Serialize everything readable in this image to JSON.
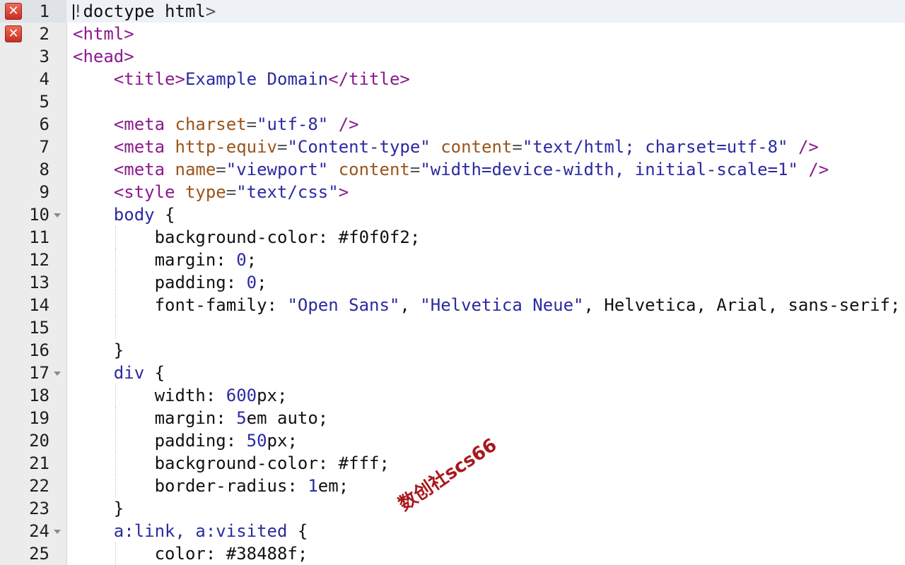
{
  "editor": {
    "lines": [
      {
        "num": "1",
        "error": true,
        "fold": false,
        "active": true,
        "tokens": [
          {
            "t": "punct",
            "v": "!"
          },
          {
            "t": "prop",
            "v": "doctype html"
          },
          {
            "t": "punct",
            "v": ">"
          }
        ]
      },
      {
        "num": "2",
        "error": true,
        "fold": false,
        "active": false,
        "tokens": [
          {
            "t": "tag",
            "v": "<html>"
          }
        ]
      },
      {
        "num": "3",
        "error": false,
        "fold": false,
        "active": false,
        "tokens": [
          {
            "t": "tag",
            "v": "<head>"
          }
        ]
      },
      {
        "num": "4",
        "error": false,
        "fold": false,
        "active": false,
        "tokens": [
          {
            "t": "prop",
            "v": "    "
          },
          {
            "t": "tag",
            "v": "<title>"
          },
          {
            "t": "str",
            "v": "Example Domain"
          },
          {
            "t": "tag",
            "v": "</title>"
          }
        ]
      },
      {
        "num": "5",
        "error": false,
        "fold": false,
        "active": false,
        "tokens": []
      },
      {
        "num": "6",
        "error": false,
        "fold": false,
        "active": false,
        "tokens": [
          {
            "t": "prop",
            "v": "    "
          },
          {
            "t": "tag",
            "v": "<meta "
          },
          {
            "t": "attr",
            "v": "charset"
          },
          {
            "t": "punct",
            "v": "="
          },
          {
            "t": "str",
            "v": "\"utf-8\""
          },
          {
            "t": "tag",
            "v": " />"
          }
        ]
      },
      {
        "num": "7",
        "error": false,
        "fold": false,
        "active": false,
        "tokens": [
          {
            "t": "prop",
            "v": "    "
          },
          {
            "t": "tag",
            "v": "<meta "
          },
          {
            "t": "attr",
            "v": "http-equiv"
          },
          {
            "t": "punct",
            "v": "="
          },
          {
            "t": "str",
            "v": "\"Content-type\""
          },
          {
            "t": "prop",
            "v": " "
          },
          {
            "t": "attr",
            "v": "content"
          },
          {
            "t": "punct",
            "v": "="
          },
          {
            "t": "str",
            "v": "\"text/html; charset=utf-8\""
          },
          {
            "t": "tag",
            "v": " />"
          }
        ]
      },
      {
        "num": "8",
        "error": false,
        "fold": false,
        "active": false,
        "tokens": [
          {
            "t": "prop",
            "v": "    "
          },
          {
            "t": "tag",
            "v": "<meta "
          },
          {
            "t": "attr",
            "v": "name"
          },
          {
            "t": "punct",
            "v": "="
          },
          {
            "t": "str",
            "v": "\"viewport\""
          },
          {
            "t": "prop",
            "v": " "
          },
          {
            "t": "attr",
            "v": "content"
          },
          {
            "t": "punct",
            "v": "="
          },
          {
            "t": "str",
            "v": "\"width=device-width, initial-scale=1\""
          },
          {
            "t": "tag",
            "v": " />"
          }
        ]
      },
      {
        "num": "9",
        "error": false,
        "fold": false,
        "active": false,
        "tokens": [
          {
            "t": "prop",
            "v": "    "
          },
          {
            "t": "tag",
            "v": "<style "
          },
          {
            "t": "attr",
            "v": "type"
          },
          {
            "t": "punct",
            "v": "="
          },
          {
            "t": "str",
            "v": "\"text/css\""
          },
          {
            "t": "tag",
            "v": ">"
          }
        ]
      },
      {
        "num": "10",
        "error": false,
        "fold": true,
        "active": false,
        "tokens": [
          {
            "t": "prop",
            "v": "    "
          },
          {
            "t": "sel",
            "v": "body"
          },
          {
            "t": "prop",
            "v": " {"
          }
        ]
      },
      {
        "num": "11",
        "error": false,
        "fold": false,
        "active": false,
        "guide": true,
        "tokens": [
          {
            "t": "prop",
            "v": "        background-color: #f0f0f2;"
          }
        ]
      },
      {
        "num": "12",
        "error": false,
        "fold": false,
        "active": false,
        "guide": true,
        "tokens": [
          {
            "t": "prop",
            "v": "        margin: "
          },
          {
            "t": "num",
            "v": "0"
          },
          {
            "t": "prop",
            "v": ";"
          }
        ]
      },
      {
        "num": "13",
        "error": false,
        "fold": false,
        "active": false,
        "guide": true,
        "tokens": [
          {
            "t": "prop",
            "v": "        padding: "
          },
          {
            "t": "num",
            "v": "0"
          },
          {
            "t": "prop",
            "v": ";"
          }
        ]
      },
      {
        "num": "14",
        "error": false,
        "fold": false,
        "active": false,
        "guide": true,
        "tokens": [
          {
            "t": "prop",
            "v": "        font-family: "
          },
          {
            "t": "str",
            "v": "\"Open Sans\""
          },
          {
            "t": "prop",
            "v": ", "
          },
          {
            "t": "str",
            "v": "\"Helvetica Neue\""
          },
          {
            "t": "prop",
            "v": ", Helvetica, Arial, sans-serif;"
          }
        ]
      },
      {
        "num": "15",
        "error": false,
        "fold": false,
        "active": false,
        "guide": true,
        "tokens": []
      },
      {
        "num": "16",
        "error": false,
        "fold": false,
        "active": false,
        "tokens": [
          {
            "t": "prop",
            "v": "    }"
          }
        ]
      },
      {
        "num": "17",
        "error": false,
        "fold": true,
        "active": false,
        "tokens": [
          {
            "t": "prop",
            "v": "    "
          },
          {
            "t": "sel",
            "v": "div"
          },
          {
            "t": "prop",
            "v": " {"
          }
        ]
      },
      {
        "num": "18",
        "error": false,
        "fold": false,
        "active": false,
        "guide": true,
        "tokens": [
          {
            "t": "prop",
            "v": "        width: "
          },
          {
            "t": "num",
            "v": "600"
          },
          {
            "t": "prop",
            "v": "px;"
          }
        ]
      },
      {
        "num": "19",
        "error": false,
        "fold": false,
        "active": false,
        "guide": true,
        "tokens": [
          {
            "t": "prop",
            "v": "        margin: "
          },
          {
            "t": "num",
            "v": "5"
          },
          {
            "t": "prop",
            "v": "em auto;"
          }
        ]
      },
      {
        "num": "20",
        "error": false,
        "fold": false,
        "active": false,
        "guide": true,
        "tokens": [
          {
            "t": "prop",
            "v": "        padding: "
          },
          {
            "t": "num",
            "v": "50"
          },
          {
            "t": "prop",
            "v": "px;"
          }
        ]
      },
      {
        "num": "21",
        "error": false,
        "fold": false,
        "active": false,
        "guide": true,
        "tokens": [
          {
            "t": "prop",
            "v": "        background-color: #fff;"
          }
        ]
      },
      {
        "num": "22",
        "error": false,
        "fold": false,
        "active": false,
        "guide": true,
        "tokens": [
          {
            "t": "prop",
            "v": "        border-radius: "
          },
          {
            "t": "num",
            "v": "1"
          },
          {
            "t": "prop",
            "v": "em;"
          }
        ]
      },
      {
        "num": "23",
        "error": false,
        "fold": false,
        "active": false,
        "tokens": [
          {
            "t": "prop",
            "v": "    }"
          }
        ]
      },
      {
        "num": "24",
        "error": false,
        "fold": true,
        "active": false,
        "tokens": [
          {
            "t": "prop",
            "v": "    "
          },
          {
            "t": "sel",
            "v": "a:link, a:visited"
          },
          {
            "t": "prop",
            "v": " {"
          }
        ]
      },
      {
        "num": "25",
        "error": false,
        "fold": false,
        "active": false,
        "guide": true,
        "tokens": [
          {
            "t": "prop",
            "v": "        color: #38488f;"
          }
        ]
      }
    ]
  },
  "error_icon_glyph": "✕",
  "watermark": "数创社scs66",
  "colors": {
    "tag": "#8b1a8b",
    "attribute": "#9a5419",
    "string": "#2c2aa0",
    "error_icon": "#c62f24",
    "watermark": "#a8181d"
  }
}
